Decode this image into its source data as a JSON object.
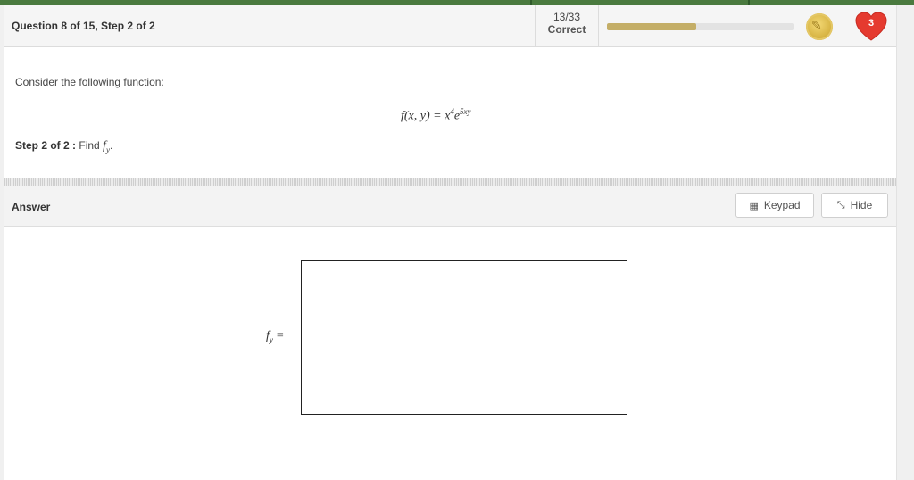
{
  "header": {
    "question_label": "Question 8 of 15, Step 2 of 2",
    "score": "13/33",
    "score_label": "Correct",
    "progress_fraction": 0.48,
    "hearts_count": "3",
    "progress_color": "#c4ae67",
    "heart_color": "#e53a2f"
  },
  "question": {
    "prompt": "Consider the following function:",
    "function_lhs": "f(x, y) = x",
    "function_exp1": "4",
    "function_base": "e",
    "function_exp2": "5xy",
    "step_label": "Step 2 of 2 :",
    "step_text": "Find",
    "step_var": "f",
    "step_sub": "y",
    "step_end": "."
  },
  "answer": {
    "section_label": "Answer",
    "keypad_label": "Keypad",
    "hide_label": "Hide",
    "keypad_icon": "calculator-icon",
    "hide_icon": "collapse-arrows-icon",
    "input_var": "f",
    "input_sub": "y",
    "input_eq": "=",
    "input_value": ""
  }
}
